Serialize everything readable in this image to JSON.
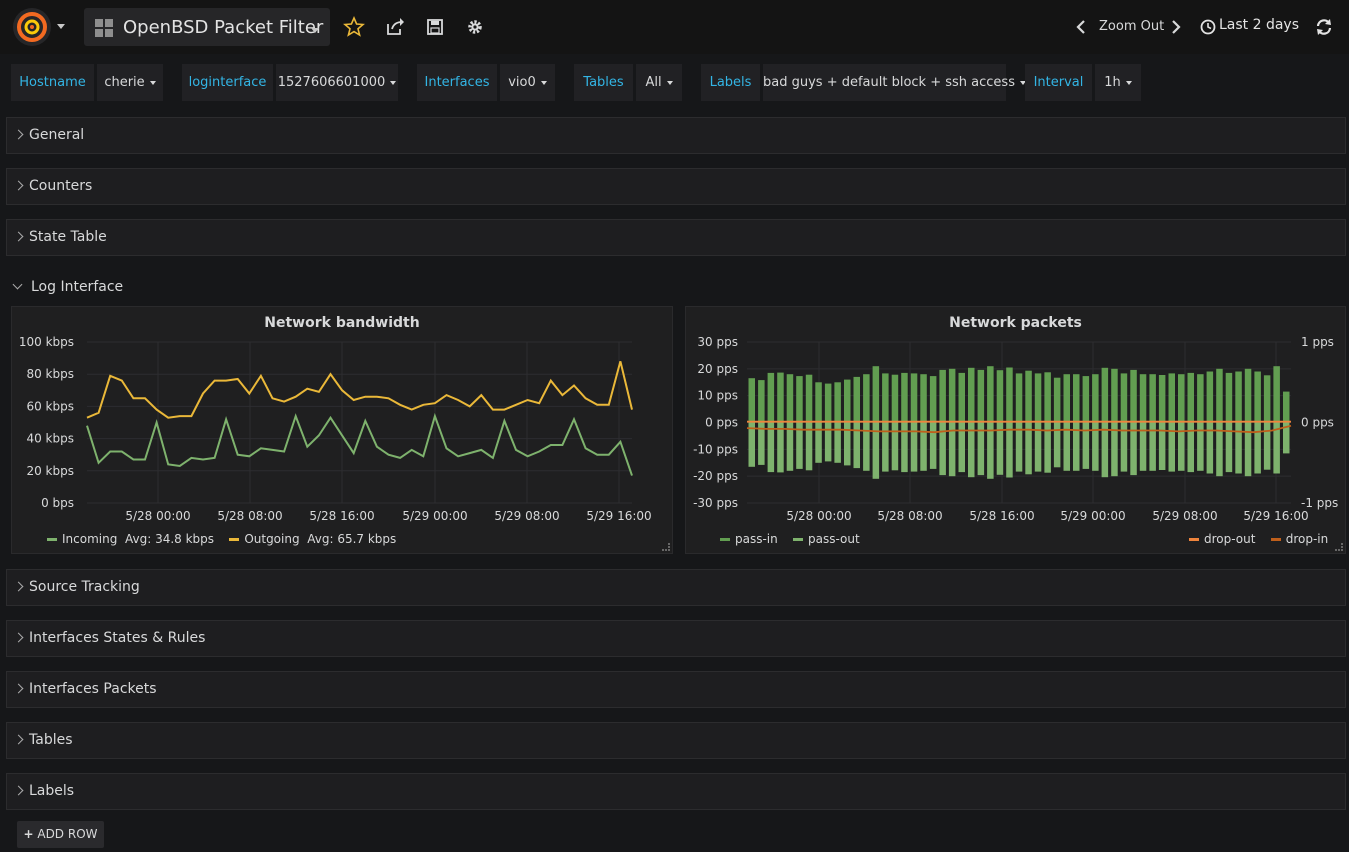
{
  "dashboard": {
    "title": "OpenBSD Packet Filter"
  },
  "nav": {
    "zoom_out": "Zoom Out",
    "time_range": "Last 2 days",
    "add_row": "ADD ROW"
  },
  "variables": [
    {
      "label": "Hostname",
      "value": "cherie"
    },
    {
      "label": "loginterface",
      "value": "1527606601000"
    },
    {
      "label": "Interfaces",
      "value": "vio0"
    },
    {
      "label": "Tables",
      "value": "All"
    },
    {
      "label": "Labels",
      "value": "bad guys + default block + ssh access"
    },
    {
      "label": "Interval",
      "value": "1h"
    }
  ],
  "rows": {
    "general": "General",
    "counters": "Counters",
    "state_table": "State Table",
    "log_interface": "Log Interface",
    "source_tracking": "Source Tracking",
    "interfaces_states": "Interfaces States & Rules",
    "interfaces_packets": "Interfaces Packets",
    "tables": "Tables",
    "labels": "Labels"
  },
  "colors": {
    "incoming": "#7eb26d",
    "outgoing": "#eab839",
    "pass": "#629e51",
    "drop_out": "#ef843c",
    "drop_in": "#bf5f1b",
    "variable_label": "#33b5e5"
  },
  "chart_data": [
    {
      "type": "line",
      "title": "Network bandwidth",
      "x_ticks": [
        "5/28 00:00",
        "5/28 08:00",
        "5/28 16:00",
        "5/29 00:00",
        "5/29 08:00",
        "5/29 16:00"
      ],
      "y_ticks": [
        "100 kbps",
        "80 kbps",
        "60 kbps",
        "40 kbps",
        "20 kbps",
        "0 bps"
      ],
      "ylim": [
        0,
        100
      ],
      "unit": "kbps",
      "series": [
        {
          "name": "Incoming",
          "legend_value": "Avg: 34.8 kbps",
          "values": [
            48,
            25,
            32,
            32,
            27,
            27,
            50,
            24,
            23,
            28,
            27,
            28,
            52,
            30,
            29,
            34,
            33,
            32,
            54,
            35,
            42,
            53,
            42,
            31,
            51,
            35,
            30,
            28,
            33,
            29,
            54,
            34,
            29,
            31,
            33,
            28,
            51,
            33,
            29,
            32,
            36,
            36,
            52,
            34,
            30,
            30,
            38,
            17
          ]
        },
        {
          "name": "Outgoing",
          "legend_value": "Avg: 65.7 kbps",
          "values": [
            53,
            56,
            79,
            76,
            65,
            65,
            58,
            53,
            54,
            54,
            68,
            76,
            76,
            77,
            68,
            79,
            65,
            63,
            66,
            71,
            69,
            80,
            70,
            64,
            66,
            66,
            65,
            61,
            58,
            61,
            62,
            67,
            64,
            60,
            67,
            58,
            58,
            61,
            64,
            62,
            76,
            67,
            73,
            65,
            61,
            61,
            88,
            58
          ]
        }
      ]
    },
    {
      "type": "bar",
      "title": "Network packets",
      "x_ticks": [
        "5/28 00:00",
        "5/28 08:00",
        "5/28 16:00",
        "5/29 00:00",
        "5/29 08:00",
        "5/29 16:00"
      ],
      "y_ticks_left": [
        "30 pps",
        "20 pps",
        "10 pps",
        "0 pps",
        "-10 pps",
        "-20 pps",
        "-30 pps"
      ],
      "y_ticks_right": [
        "1 pps",
        "0 pps",
        "-1 pps"
      ],
      "ylim": [
        -30,
        30
      ],
      "ylim_right": [
        -1,
        1
      ],
      "unit": "pps",
      "series": [
        {
          "name": "pass-in",
          "axis": "left",
          "values": [
            16.5,
            15.8,
            18.5,
            18.6,
            18.0,
            17.3,
            17.8,
            15.0,
            14.5,
            15.0,
            16.0,
            17.0,
            18.0,
            21.0,
            18.3,
            17.8,
            18.5,
            18.3,
            18.0,
            17.3,
            19.6,
            20.0,
            18.5,
            20.4,
            19.6,
            21.0,
            19.5,
            20.5,
            18.3,
            19.3,
            18.3,
            18.7,
            16.7,
            18.0,
            18.0,
            17.3,
            18.0,
            20.4,
            20.0,
            18.3,
            19.6,
            18.0,
            18.0,
            17.7,
            18.3,
            18.0,
            18.5,
            18.0,
            19.0,
            20.0,
            18.5,
            19.0,
            20.0,
            19.0,
            17.6,
            21.0,
            11.5
          ]
        },
        {
          "name": "pass-out",
          "axis": "left",
          "values": [
            -16.5,
            -15.8,
            -18.5,
            -18.6,
            -18.0,
            -17.3,
            -17.8,
            -15.0,
            -14.5,
            -15.0,
            -16.0,
            -17.0,
            -18.0,
            -21.0,
            -18.3,
            -17.8,
            -18.5,
            -18.3,
            -18.0,
            -17.3,
            -19.6,
            -20.0,
            -18.5,
            -20.4,
            -19.6,
            -21.0,
            -19.5,
            -20.5,
            -18.3,
            -19.3,
            -18.3,
            -18.7,
            -16.7,
            -18.0,
            -18.0,
            -17.3,
            -18.0,
            -20.4,
            -20.0,
            -18.3,
            -19.6,
            -18.0,
            -18.0,
            -17.7,
            -18.3,
            -18.0,
            -18.5,
            -18.0,
            -19.0,
            -20.0,
            -18.5,
            -19.0,
            -20.0,
            -19.0,
            -17.6,
            -19.0,
            -11.5
          ]
        },
        {
          "name": "drop-out",
          "axis": "right",
          "values": [
            0.01,
            0.01,
            0.01,
            0.01,
            0.01,
            0.01,
            0.01,
            0.01,
            0.01,
            0.01,
            0.01,
            0.01,
            0.01,
            0.01,
            0.01,
            0.01,
            0.01,
            0.01,
            0.01,
            0.01,
            0.01,
            0.01,
            0.01,
            0.01,
            0.01,
            0.01,
            0.01,
            0.01,
            0.01,
            0.01
          ]
        },
        {
          "name": "drop-in",
          "axis": "right",
          "values": [
            -0.07,
            -0.08,
            -0.08,
            -0.09,
            -0.09,
            -0.09,
            -0.1,
            -0.11,
            -0.11,
            -0.11,
            -0.12,
            -0.1,
            -0.1,
            -0.1,
            -0.09,
            -0.09,
            -0.1,
            -0.09,
            -0.1,
            -0.09,
            -0.1,
            -0.1,
            -0.1,
            -0.11,
            -0.1,
            -0.1,
            -0.11,
            -0.12,
            -0.1,
            -0.04
          ]
        }
      ]
    }
  ]
}
